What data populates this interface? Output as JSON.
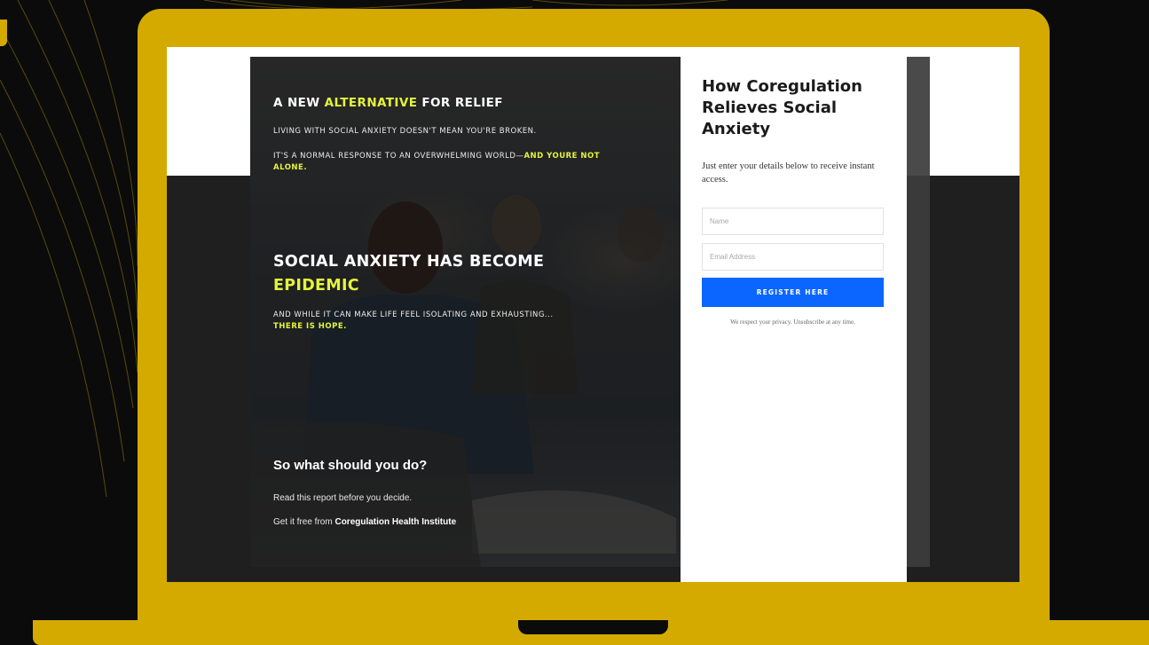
{
  "colors": {
    "laptop": "#d4aa00",
    "accent_yellow": "#e4f33c",
    "button_blue": "#0a66ff",
    "background": "#0b0b0b"
  },
  "hero": {
    "kicker_prefix": "A NEW ",
    "kicker_highlight": "ALTERNATIVE",
    "kicker_suffix": " FOR RELIEF",
    "line1": "LIVING WITH SOCIAL ANXIETY DOESN'T MEAN YOU'RE BROKEN.",
    "line2_prefix": "IT'S A NORMAL RESPONSE TO AN OVERWHELMING WORLD—",
    "line2_highlight": "AND YOURE NOT ALONE.",
    "headline_main": "SOCIAL ANXIETY HAS BECOME",
    "headline_highlight": "EPIDEMIC",
    "line3_prefix": "AND WHILE IT CAN MAKE LIFE FEEL ISOLATING AND EXHAUSTING...",
    "line3_highlight": "THERE IS HOPE.",
    "question": "So what should you do?",
    "read": "Read this report before you decide.",
    "getit_prefix": "Get it free from ",
    "getit_org": "Coregulation Health Institute"
  },
  "form": {
    "title": "How Coregulation Relieves Social Anxiety",
    "subtitle": "Just enter your details below to receive instant access.",
    "name_placeholder": "Name",
    "email_placeholder": "Email Address",
    "register_label": "REGISTER HERE",
    "privacy": "We respect your privacy. Unsubscribe at any time."
  }
}
